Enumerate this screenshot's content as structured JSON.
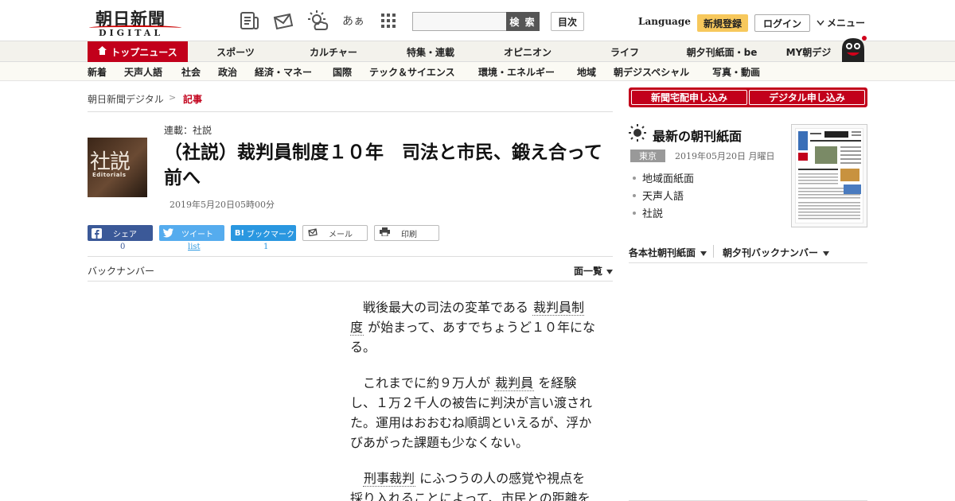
{
  "header": {
    "logo_jp": "朝日新聞",
    "logo_en": "DIGITAL",
    "icons": [
      "newspaper-icon",
      "mail-icon",
      "weather-icon",
      "font-size-icon",
      "grid-icon"
    ],
    "font_icon_text": "あぁ",
    "search_placeholder": "",
    "search_button": "検 索",
    "toc_button": "目次",
    "language": "Language",
    "register": "新規登録",
    "login": "ログイン",
    "menu": "メニュー"
  },
  "nav_main": [
    {
      "label": "トップニュース",
      "active": true
    },
    {
      "label": "スポーツ"
    },
    {
      "label": "カルチャー"
    },
    {
      "label": "特集・連載"
    },
    {
      "label": "オピニオン"
    },
    {
      "label": "ライフ"
    },
    {
      "label": "朝夕刊紙面・be"
    },
    {
      "label": "MY朝デジ"
    }
  ],
  "nav_sub": [
    "新着",
    "天声人語",
    "社会",
    "政治",
    "経済・マネー",
    "国際",
    "テック＆サイエンス",
    "環境・エネルギー",
    "地域",
    "朝デジスペシャル",
    "写真・動画"
  ],
  "breadcrumb": {
    "home": "朝日新聞デジタル",
    "sep": ">",
    "current": "記事"
  },
  "article": {
    "thumb_big": "社説",
    "thumb_small": "Editorials",
    "series": "連載：社説",
    "headline": "（社説）裁判員制度１０年　司法と市民、鍛え合って前へ",
    "date": "2019年5月20日05時00分",
    "share": {
      "facebook": {
        "label": "シェア",
        "count": "0"
      },
      "twitter": {
        "label": "ツイート",
        "count": "list"
      },
      "hatena": {
        "label": "ブックマーク",
        "icon_text": "B!",
        "count": "1"
      },
      "mail": "メール",
      "print": "印刷"
    },
    "backnumber": "バックナンバー",
    "ichiran": "面一覧",
    "paragraphs": [
      {
        "pre": "戦後最大の司法の変革である",
        "kw": "裁判員制度",
        "post": "が始まって、あすでちょうど１０年になる。"
      },
      {
        "pre": "これまでに約９万人が",
        "kw": "裁判員",
        "post": "を経験し、１万２千人の被告に判決が言い渡された。運用はおおむね順調といえるが、浮かびあがった課題も少なくない。"
      },
      {
        "pre": "",
        "kw": "刑事裁判",
        "post": "にふつうの人の感覚や視点を採り入れることによって、市民との距離を"
      }
    ]
  },
  "sidebar": {
    "subscribe_paper": "新聞宅配申し込み",
    "subscribe_digital": "デジタル申し込み",
    "latest_title": "最新の朝刊紙面",
    "region": "東京",
    "edition_date": "2019年05月20日 月曜日",
    "links": [
      "地域面紙面",
      "天声人語",
      "社説"
    ],
    "drop1": "各本社朝刊紙面",
    "drop2": "朝夕刊バックナンバー"
  },
  "colors": {
    "brand_red": "#c2001b",
    "facebook": "#3b5998",
    "twitter": "#55acee",
    "hatena": "#2a97e0",
    "register": "#f7c85c"
  }
}
